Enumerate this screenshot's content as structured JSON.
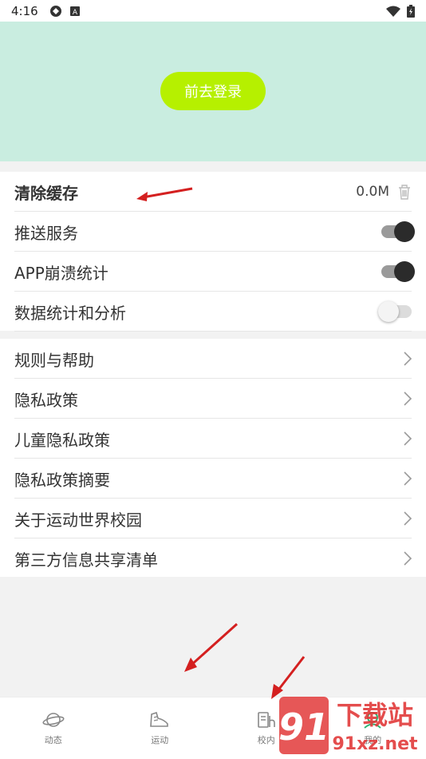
{
  "status_bar": {
    "time": "4:16"
  },
  "hero": {
    "login_label": "前去登录",
    "login_color": "#b6f000",
    "background": "#c9ede0"
  },
  "settings_group_1": [
    {
      "label": "清除缓存",
      "value": "0.0M",
      "icon": "trash-icon"
    },
    {
      "label": "推送服务",
      "toggle": "on"
    },
    {
      "label": "APP崩溃统计",
      "toggle": "on"
    },
    {
      "label": "数据统计和分析",
      "toggle": "off"
    }
  ],
  "settings_group_2": [
    {
      "label": "规则与帮助"
    },
    {
      "label": "隐私政策"
    },
    {
      "label": "儿童隐私政策"
    },
    {
      "label": "隐私政策摘要"
    },
    {
      "label": "关于运动世界校园"
    },
    {
      "label": "第三方信息共享清单"
    }
  ],
  "bottom_nav": [
    {
      "label": "动态",
      "icon": "planet-icon"
    },
    {
      "label": "运动",
      "icon": "sneaker-icon"
    },
    {
      "label": "校内",
      "icon": "campus-icon"
    },
    {
      "label": "我的",
      "icon": "profile-icon"
    }
  ],
  "watermark": {
    "line1": "下载站",
    "line2": "91xz.net"
  }
}
